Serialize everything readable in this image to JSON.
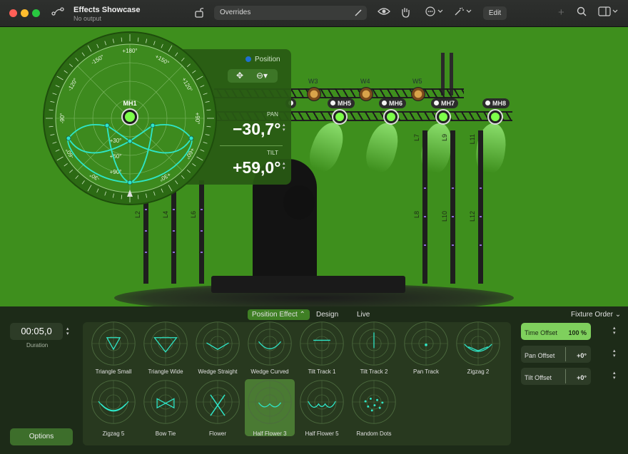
{
  "titlebar": {
    "title": "Effects Showcase",
    "subtitle": "No output",
    "search_field": "Overrides",
    "edit_label": "Edit",
    "icons": [
      "route-icon",
      "lock-open-icon",
      "paintbrush-icon",
      "eye-icon",
      "hand-icon",
      "ellipsis-menu-icon",
      "sparkles-menu-icon",
      "plus-icon",
      "search-icon",
      "layout-icon"
    ]
  },
  "stage": {
    "wash_lights": [
      "W3",
      "W4",
      "W5"
    ],
    "moving_heads": [
      "MH5",
      "MH6",
      "MH7",
      "MH8"
    ],
    "partial_label": "4",
    "bars": [
      "L2",
      "L4",
      "L6",
      "L7",
      "L8",
      "L9",
      "L10",
      "L11",
      "L12"
    ]
  },
  "position_panel": {
    "title": "Position",
    "pan_label": "PAN",
    "pan_value": "−30,7°",
    "tilt_label": "TILT",
    "tilt_value": "+59,0°",
    "fixture": "MH1",
    "dial_labels": [
      "+180°",
      "-150°",
      "+150°",
      "-120°",
      "+120°",
      "-90°",
      "+90°",
      "-60°",
      "+60°",
      "-30°",
      "+30°",
      "+30°",
      "+60°",
      "+90°"
    ]
  },
  "tabs": {
    "position_effect": "Position Effect",
    "design": "Design",
    "live": "Live"
  },
  "fixture_order": "Fixture Order",
  "duration": {
    "value": "00:05,0",
    "label": "Duration"
  },
  "options_label": "Options",
  "effects": [
    {
      "label": "Triangle Small"
    },
    {
      "label": "Triangle Wide"
    },
    {
      "label": "Wedge Straight"
    },
    {
      "label": "Wedge Curved"
    },
    {
      "label": "Tilt Track 1"
    },
    {
      "label": "Tilt Track 2"
    },
    {
      "label": "Pan Track"
    },
    {
      "label": "Zigzag 2"
    },
    {
      "label": "Zigzag 5"
    },
    {
      "label": "Bow Tie"
    },
    {
      "label": "Flower"
    },
    {
      "label": "Half Flower 3",
      "selected": true
    },
    {
      "label": "Half Flower 5"
    },
    {
      "label": "Random Dots"
    }
  ],
  "offsets": [
    {
      "name": "Time Offset",
      "value": "100 %",
      "active": true
    },
    {
      "name": "Pan Offset",
      "value": "+0°",
      "active": false
    },
    {
      "name": "Tilt Offset",
      "value": "+0°",
      "active": false
    }
  ],
  "colors": {
    "accent": "#7fd05d",
    "stage_green": "#3e8f1d",
    "beam": "#7dff4a",
    "path": "#2ee6c8"
  }
}
